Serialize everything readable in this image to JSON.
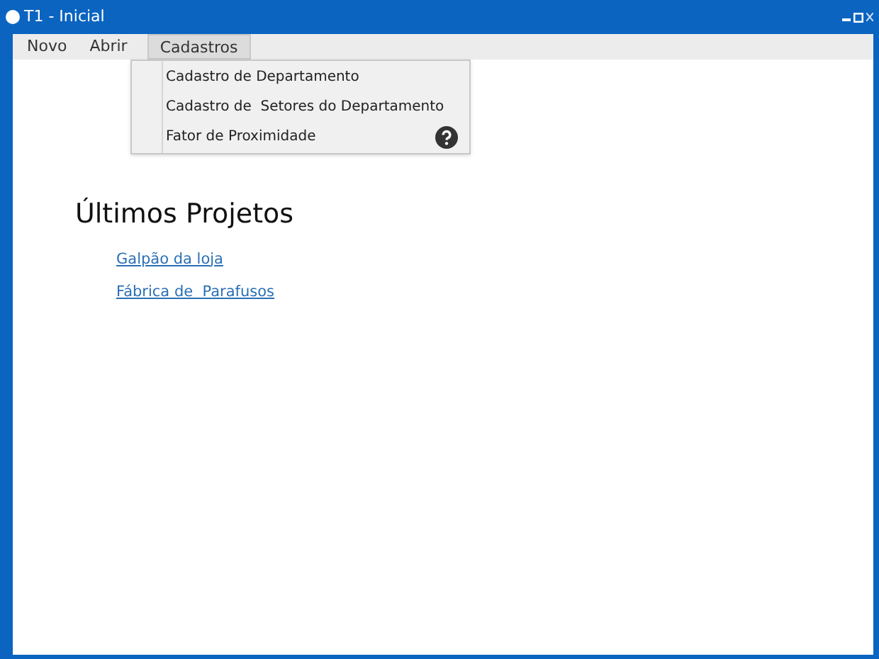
{
  "window": {
    "title": "T1 - Inicial"
  },
  "menu_bar": [
    {
      "label": "Novo",
      "selected": false
    },
    {
      "label": "Abrir",
      "selected": false
    },
    {
      "label": "Cadastros",
      "selected": true
    }
  ],
  "dropdown": [
    {
      "label": "Cadastro de Departamento",
      "help": false
    },
    {
      "label": "Cadastro de  Setores do Departamento",
      "help": false
    },
    {
      "label": "Fator de Proximidade",
      "help": true
    }
  ],
  "recent_projects": {
    "title": "Últimos Projetos",
    "links": [
      "Galpão da loja",
      "Fábrica de  Parafusos"
    ]
  }
}
